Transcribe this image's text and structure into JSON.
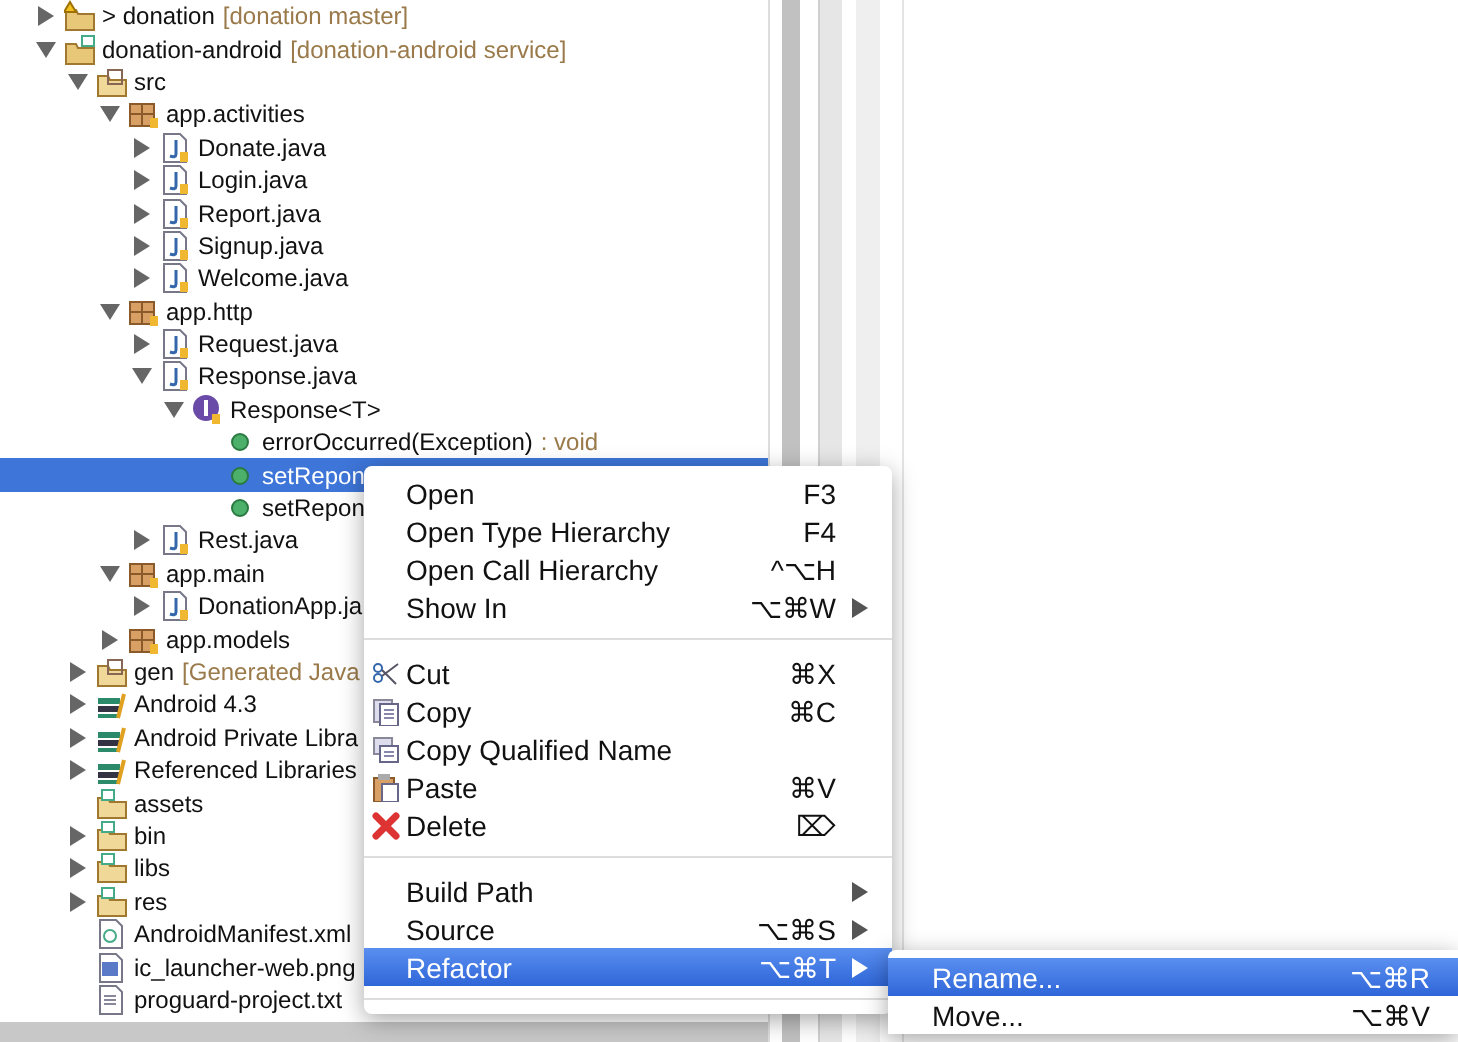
{
  "tree": [
    {
      "label": "> donation",
      "decoration": "[donation master]",
      "kind": "project-warning",
      "expanded": false,
      "selected": false
    },
    {
      "label": "donation-android",
      "decoration": "[donation-android service]",
      "kind": "project",
      "expanded": true,
      "selected": false,
      "children": [
        {
          "label": "src",
          "kind": "source-folder",
          "expanded": true,
          "selected": false,
          "children": [
            {
              "label": "app.activities",
              "kind": "package",
              "expanded": true,
              "selected": false,
              "children": [
                {
                  "label": "Donate.java",
                  "kind": "java-file",
                  "expanded": false,
                  "selected": false
                },
                {
                  "label": "Login.java",
                  "kind": "java-file",
                  "expanded": false,
                  "selected": false
                },
                {
                  "label": "Report.java",
                  "kind": "java-file",
                  "expanded": false,
                  "selected": false
                },
                {
                  "label": "Signup.java",
                  "kind": "java-file",
                  "expanded": false,
                  "selected": false
                },
                {
                  "label": "Welcome.java",
                  "kind": "java-file",
                  "expanded": false,
                  "selected": false
                }
              ]
            },
            {
              "label": "app.http",
              "kind": "package",
              "expanded": true,
              "selected": false,
              "children": [
                {
                  "label": "Request.java",
                  "kind": "java-file",
                  "expanded": false,
                  "selected": false
                },
                {
                  "label": "Response.java",
                  "kind": "java-file",
                  "expanded": true,
                  "selected": false,
                  "children": [
                    {
                      "label": "Response<T>",
                      "kind": "class",
                      "expanded": true,
                      "selected": false,
                      "children": [
                        {
                          "label": "errorOccurred(Exception)",
                          "decoration": ": void",
                          "kind": "method",
                          "selected": false
                        },
                        {
                          "label": "setRepon",
                          "kind": "method",
                          "selected": true
                        },
                        {
                          "label": "setRepon",
                          "kind": "method",
                          "selected": false
                        }
                      ]
                    }
                  ]
                },
                {
                  "label": "Rest.java",
                  "kind": "java-file",
                  "expanded": false,
                  "selected": false
                }
              ]
            },
            {
              "label": "app.main",
              "kind": "package",
              "expanded": true,
              "selected": false,
              "children": [
                {
                  "label": "DonationApp.ja",
                  "kind": "java-file",
                  "expanded": false,
                  "selected": false
                }
              ]
            },
            {
              "label": "app.models",
              "kind": "package",
              "expanded": false,
              "selected": false
            }
          ]
        },
        {
          "label": "gen",
          "decoration": "[Generated Java",
          "kind": "source-folder",
          "expanded": false,
          "selected": false
        },
        {
          "label": "Android 4.3",
          "kind": "library",
          "expanded": false,
          "selected": false
        },
        {
          "label": "Android Private Libra",
          "kind": "library",
          "expanded": false,
          "selected": false
        },
        {
          "label": "Referenced Libraries",
          "kind": "library",
          "expanded": false,
          "selected": false
        },
        {
          "label": "assets",
          "kind": "folder",
          "selected": false
        },
        {
          "label": "bin",
          "kind": "folder",
          "expanded": false,
          "selected": false
        },
        {
          "label": "libs",
          "kind": "folder",
          "expanded": false,
          "selected": false
        },
        {
          "label": "res",
          "kind": "folder",
          "expanded": false,
          "selected": false
        },
        {
          "label": "AndroidManifest.xml",
          "kind": "xml-file",
          "selected": false
        },
        {
          "label": "ic_launcher-web.png",
          "kind": "image-file",
          "selected": false
        },
        {
          "label": "proguard-project.txt",
          "kind": "text-file",
          "selected": false
        }
      ]
    }
  ],
  "context_menu": [
    {
      "kind": "item",
      "label": "Open",
      "shortcut": "F3",
      "submenu": false,
      "selected": false
    },
    {
      "kind": "item",
      "label": "Open Type Hierarchy",
      "shortcut": "F4",
      "submenu": false,
      "selected": false
    },
    {
      "kind": "item",
      "label": "Open Call Hierarchy",
      "shortcut": "^⌥H",
      "submenu": false,
      "selected": false
    },
    {
      "kind": "item",
      "label": "Show In",
      "shortcut": "⌥⌘W",
      "submenu": true,
      "selected": false
    },
    {
      "kind": "separator"
    },
    {
      "kind": "item",
      "label": "Cut",
      "shortcut": "⌘X",
      "submenu": false,
      "selected": false
    },
    {
      "kind": "item",
      "label": "Copy",
      "shortcut": "⌘C",
      "submenu": false,
      "selected": false
    },
    {
      "kind": "item",
      "label": "Copy Qualified Name",
      "submenu": false,
      "selected": false
    },
    {
      "kind": "item",
      "label": "Paste",
      "shortcut": "⌘V",
      "submenu": false,
      "selected": false
    },
    {
      "kind": "item",
      "label": "Delete",
      "shortcut": "⌦",
      "submenu": false,
      "selected": false
    },
    {
      "kind": "separator"
    },
    {
      "kind": "item",
      "label": "Build Path",
      "submenu": true,
      "selected": false
    },
    {
      "kind": "item",
      "label": "Source",
      "shortcut": "⌥⌘S",
      "submenu": true,
      "selected": false
    },
    {
      "kind": "item",
      "label": "Refactor",
      "shortcut": "⌥⌘T",
      "submenu": true,
      "selected": true
    },
    {
      "kind": "separator"
    }
  ],
  "submenu": [
    {
      "label": "Rename...",
      "shortcut": "⌥⌘R",
      "selected": true
    },
    {
      "label": "Move...",
      "shortcut": "⌥⌘V",
      "selected": false
    }
  ]
}
